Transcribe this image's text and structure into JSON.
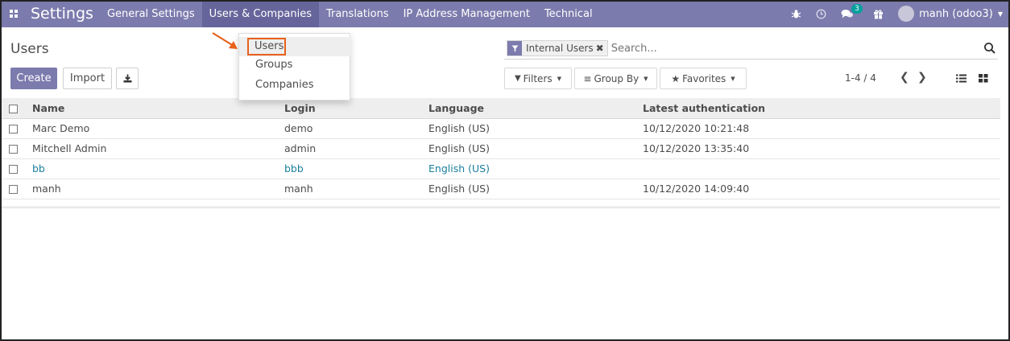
{
  "navbar": {
    "app_title": "Settings",
    "menu": [
      "General Settings",
      "Users & Companies",
      "Translations",
      "IP Address Management",
      "Technical"
    ],
    "active_menu": "Users & Companies",
    "chat_badge": "3",
    "user_label": "manh (odoo3)"
  },
  "control_panel": {
    "title": "Users",
    "create_label": "Create",
    "import_label": "Import",
    "facet_label": "Internal Users",
    "search_placeholder": "Search...",
    "filters_label": "Filters",
    "groupby_label": "Group By",
    "favorites_label": "Favorites",
    "pager": "1-4 / 4"
  },
  "dropdown": {
    "items": [
      "Users",
      "Groups",
      "Companies"
    ],
    "selected": "Users"
  },
  "table": {
    "columns": [
      "Name",
      "Login",
      "Language",
      "Latest authentication"
    ],
    "rows": [
      {
        "name": "Marc Demo",
        "login": "demo",
        "language": "English (US)",
        "latest_auth": "10/12/2020 10:21:48"
      },
      {
        "name": "Mitchell Admin",
        "login": "admin",
        "language": "English (US)",
        "latest_auth": "10/12/2020 13:35:40"
      },
      {
        "name": "bb",
        "login": "bbb",
        "language": "English (US)",
        "latest_auth": ""
      },
      {
        "name": "manh",
        "login": "manh",
        "language": "English (US)",
        "latest_auth": "10/12/2020 14:09:40"
      }
    ]
  },
  "colors": {
    "navbar": "#7c7bad",
    "navbar_active": "#66659b",
    "accent_link": "#1a7f9c",
    "highlight_border": "#e8601c"
  }
}
